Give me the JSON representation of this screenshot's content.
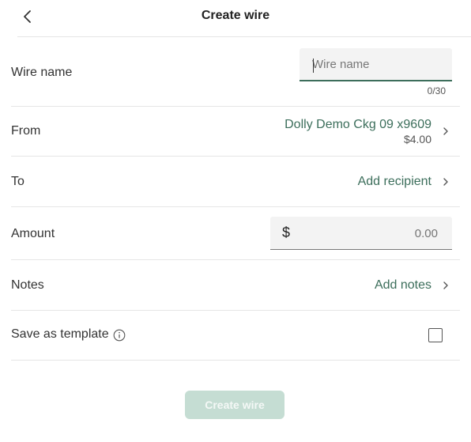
{
  "header": {
    "title": "Create wire",
    "back_icon": "chevron-left-icon"
  },
  "form": {
    "wire_name": {
      "label": "Wire name",
      "value": "",
      "placeholder": "Wire name",
      "counter": "0/30"
    },
    "from": {
      "label": "From",
      "account_name": "Dolly Demo Ckg 09 x9609",
      "balance": "$4.00"
    },
    "to": {
      "label": "To",
      "action": "Add recipient"
    },
    "amount": {
      "label": "Amount",
      "currency_symbol": "$",
      "placeholder": "0.00",
      "value": ""
    },
    "notes": {
      "label": "Notes",
      "action": "Add notes"
    },
    "save_template": {
      "label": "Save as template",
      "info_icon": "info-icon",
      "checked": false
    }
  },
  "submit": {
    "label": "Create wire",
    "enabled": false
  },
  "colors": {
    "accent": "#3c6e5b",
    "button_disabled_bg": "#c5ddd3",
    "divider": "#e6e6e6"
  }
}
